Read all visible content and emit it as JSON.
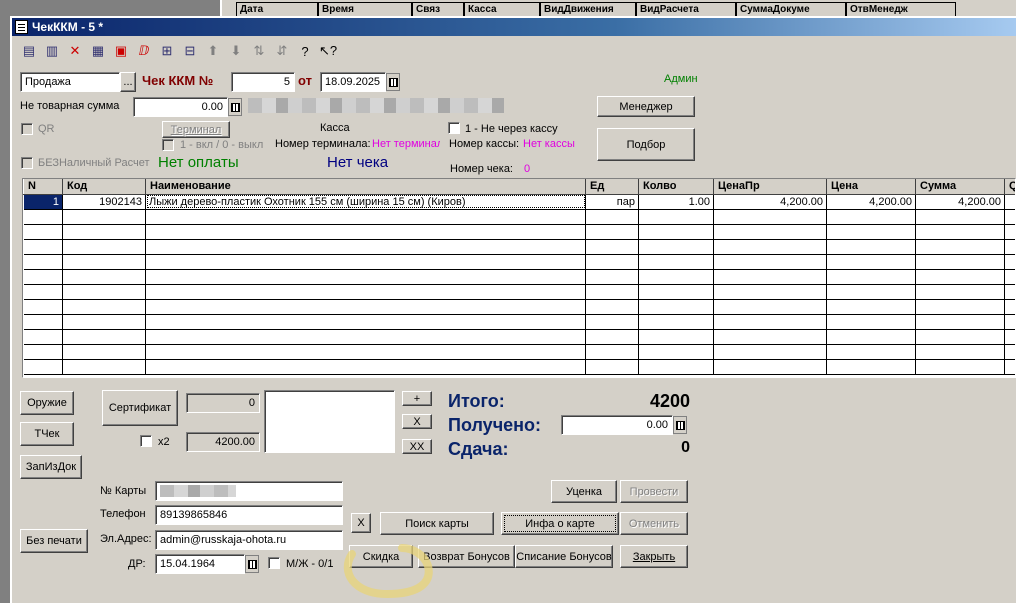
{
  "background_window": {
    "headers": [
      "Дата",
      "Время",
      "Связ",
      "Касса",
      "ВидДвижения",
      "ВидРасчета",
      "СуммаДокуме",
      "ОтвМенедж"
    ]
  },
  "window": {
    "title": "ЧекККМ - 5 *"
  },
  "toolbar": {
    "icons": [
      "new-row-icon",
      "copy-row-icon",
      "delete-row-icon",
      "edit-row-icon",
      "delete-doc-icon",
      "delete-mark-icon",
      "add-icon",
      "insert-icon",
      "move-up-icon",
      "move-down-icon",
      "sort-asc-icon",
      "sort-desc-icon",
      "help-icon",
      "whats-this-icon"
    ]
  },
  "header": {
    "operation": "Продажа",
    "check_label": "Чек ККМ №",
    "check_number": "5",
    "from_label": "от",
    "date": "18.09.2025",
    "user": "Админ",
    "nontovar_label": "Не товарная сумма",
    "nontovar_value": "0.00",
    "manager_button": "Менеджер",
    "qr_label": "QR",
    "terminal_button": "Терминал",
    "terminal_hint": "1 - вкл / 0 - выкл",
    "kassa_label": "Касса",
    "terminal_no_label": "Номер терминала:",
    "terminal_no_value": "Нет терминала",
    "not_kassa_label": "1 - Не через кассу",
    "kassa_no_label": "Номер кассы:",
    "kassa_no_value": "Нет кассы",
    "podbor_button": "Подбор",
    "cashless_label": "БЕЗНаличный Расчет",
    "no_payment": "Нет оплаты",
    "no_check": "Нет чека",
    "check_no_label": "Номер чека:",
    "check_no_value": "0"
  },
  "table": {
    "columns": [
      "N",
      "Код",
      "Наименование",
      "Ед",
      "Колво",
      "ЦенаПр",
      "Цена",
      "Сумма",
      "Q"
    ],
    "rows": [
      {
        "n": "1",
        "code": "1902143",
        "name": "Лыжи дерево-пластик Охотник 155 см  (ширина 15 см) (Киров)",
        "unit": "пар",
        "qty": "1.00",
        "price_pr": "4,200.00",
        "price": "4,200.00",
        "sum": "4,200.00"
      }
    ],
    "empty_rows": 11
  },
  "bottom": {
    "weapon_button": "Оружие",
    "tchek_button": "ТЧек",
    "zapizdok_button": "ЗапИзДок",
    "noprint_button": "Без печати",
    "certificate_button": "Сертификат",
    "cert_value": "0",
    "x2_label": "x2",
    "cert_total": "4200.00",
    "plus_button": "+",
    "x_button": "X",
    "xx_button": "XX",
    "total_label": "Итого:",
    "total_value": "4200",
    "received_label": "Получено:",
    "received_value": "0.00",
    "change_label": "Сдача:",
    "change_value": "0",
    "card_label": "№ Карты",
    "phone_label": "Телефон",
    "phone_value": "89139865846",
    "email_label": "Эл.Адрес:",
    "email_value": "admin@russkaja-ohota.ru",
    "birthday_label": "ДР:",
    "birthday_value": "15.04.1964",
    "gender_label": "М/Ж - 0/1",
    "clear_card_button": "X",
    "search_card_button": "Поиск карты",
    "card_info_button": "Инфа о карте",
    "discount_button": "Скидка",
    "return_bonus_button": "Возврат Бонусов",
    "writeoff_bonus_button": "Списание Бонусов",
    "markdown_button": "Уценка",
    "post_button": "Провести",
    "cancel_button": "Отменить",
    "close_button": "Закрыть"
  },
  "annotation_color": "#e8d47a"
}
